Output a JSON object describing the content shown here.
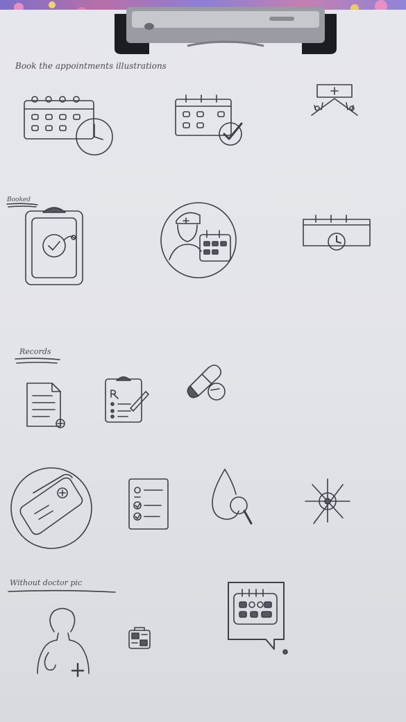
{
  "headings": {
    "book": "Book the appointments illustrations",
    "booked": "Booked",
    "records": "Records",
    "without_doctor": "Without doctor pic"
  },
  "colors": {
    "paper": "#e3e4e9",
    "pencil": "#3d3e47",
    "fabric": "#8d7fd6",
    "clip_metal": "#9a9ba3",
    "clip_black": "#1c1d22"
  },
  "icons": [
    "calendar-clock-icon",
    "calendar-check-icon",
    "clinic-roof-icon",
    "clipboard-stethoscope-icon",
    "doctor-calendar-icon",
    "calendar-clock-strip-icon",
    "document-plus-icon",
    "prescription-clipboard-icon",
    "pill-capsule-icon",
    "medical-card-icon",
    "checklist-icon",
    "blood-drop-search-icon",
    "virus-icon",
    "doctor-silhouette-icon",
    "medical-bag-icon",
    "calendar-chat-icon"
  ]
}
